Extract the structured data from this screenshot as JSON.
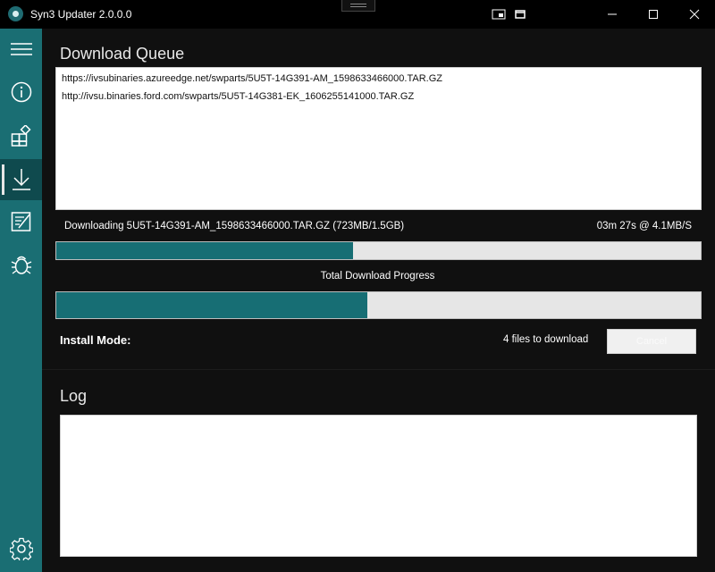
{
  "window": {
    "title": "Syn3 Updater 2.0.0.0",
    "controls": [
      "compact-overlay-icon",
      "restore-icon",
      "minimize-icon",
      "maximize-icon",
      "close-icon"
    ]
  },
  "sidebar": {
    "items": [
      {
        "icon": "hamburger-menu-icon"
      },
      {
        "icon": "info-icon"
      },
      {
        "icon": "apps-icon"
      },
      {
        "icon": "download-icon",
        "active": true
      },
      {
        "icon": "release-notes-icon"
      },
      {
        "icon": "bug-icon"
      },
      {
        "icon": "settings-gear-icon"
      }
    ]
  },
  "download": {
    "title": "Download Queue",
    "queue": [
      "https://ivsubinaries.azureedge.net/swparts/5U5T-14G391-AM_1598633466000.TAR.GZ",
      "http://ivsu.binaries.ford.com/swparts/5U5T-14G381-EK_1606255141000.TAR.GZ"
    ],
    "current_status": "Downloading 5U5T-14G391-AM_1598633466000.TAR.GZ (723MB/1.5GB)",
    "eta_speed": "03m 27s @ 4.1MB/S",
    "file_progress": 0.46,
    "total_label": "Total Download Progress",
    "total_progress": 0.483,
    "install_mode_label": "Install Mode:",
    "files_count_label": "4 files to download",
    "cancel_label": "Cancel"
  },
  "log": {
    "title": "Log",
    "content": ""
  },
  "colors": {
    "accent": "#176e74",
    "sidebar": "#1a6e73",
    "background": "#101010"
  }
}
